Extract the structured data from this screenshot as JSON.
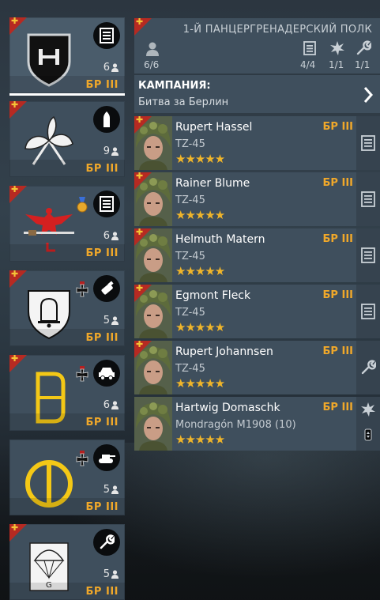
{
  "squads": [
    {
      "count": "6",
      "br": "БР III",
      "type_icon": "list-icon",
      "emblem": "shield-h-emblem",
      "has_medal": false,
      "selected": true
    },
    {
      "count": "9",
      "br": "БР III",
      "type_icon": "bullet-icon",
      "emblem": "oak-leaves-emblem",
      "has_medal": false
    },
    {
      "count": "6",
      "br": "БР III",
      "type_icon": "list-icon",
      "emblem": "red-eagle-emblem",
      "has_medal": true,
      "medal_icon": "gold-medal-icon"
    },
    {
      "count": "5",
      "br": "БР III",
      "type_icon": "grenade-icon",
      "emblem": "bell-shield-emblem",
      "has_medal": true,
      "medal_icon": "iron-cross-icon"
    },
    {
      "count": "6",
      "br": "БР III",
      "type_icon": "vehicle-icon",
      "emblem": "yellow-d-emblem",
      "has_medal": true,
      "medal_icon": "iron-cross-icon"
    },
    {
      "count": "5",
      "br": "БР III",
      "type_icon": "tank-icon",
      "emblem": "yellow-circle-emblem",
      "has_medal": true,
      "medal_icon": "iron-cross-icon"
    },
    {
      "count": "5",
      "br": "БР III",
      "type_icon": "wrench-icon",
      "emblem": "parachute-emblem",
      "has_medal": false
    }
  ],
  "header": {
    "title": "1-Й ПАНЦЕРГРЕНАДЕРСКИЙ ПОЛК",
    "soldiers": "6/6",
    "riflemen": "4/4",
    "engineers": "1/1",
    "mechanics": "1/1"
  },
  "campaign": {
    "label": "КАМПАНИЯ:",
    "value": "Битва за Берлин"
  },
  "soldiers": [
    {
      "name": "Rupert Hassel",
      "weapon": "TZ-45",
      "br": "БР III",
      "stars": "★★★★★",
      "role_icon": "list-icon",
      "flag": true
    },
    {
      "name": "Rainer Blume",
      "weapon": "TZ-45",
      "br": "БР III",
      "stars": "★★★★★",
      "role_icon": "list-icon",
      "flag": true
    },
    {
      "name": "Helmuth Matern",
      "weapon": "TZ-45",
      "br": "БР III",
      "stars": "★★★★★",
      "role_icon": "list-icon",
      "flag": true
    },
    {
      "name": "Egmont Fleck",
      "weapon": "TZ-45",
      "br": "БР III",
      "stars": "★★★★★",
      "role_icon": "list-icon",
      "flag": true
    },
    {
      "name": "Rupert Johannsen",
      "weapon": "TZ-45",
      "br": "БР III",
      "stars": "★★★★★",
      "role_icon": "wrench-icon",
      "flag": true
    },
    {
      "name": "Hartwig Domaschk",
      "weapon": "Mondragón M1908 (10)",
      "br": "БР III",
      "stars": "★★★★★",
      "role_icon": "explosion-icon",
      "flag": false
    }
  ],
  "colors": {
    "br": "#f0a82a",
    "flag": "#b62a22",
    "panel": "#3f4f5d",
    "stars": "#f0b52a"
  }
}
